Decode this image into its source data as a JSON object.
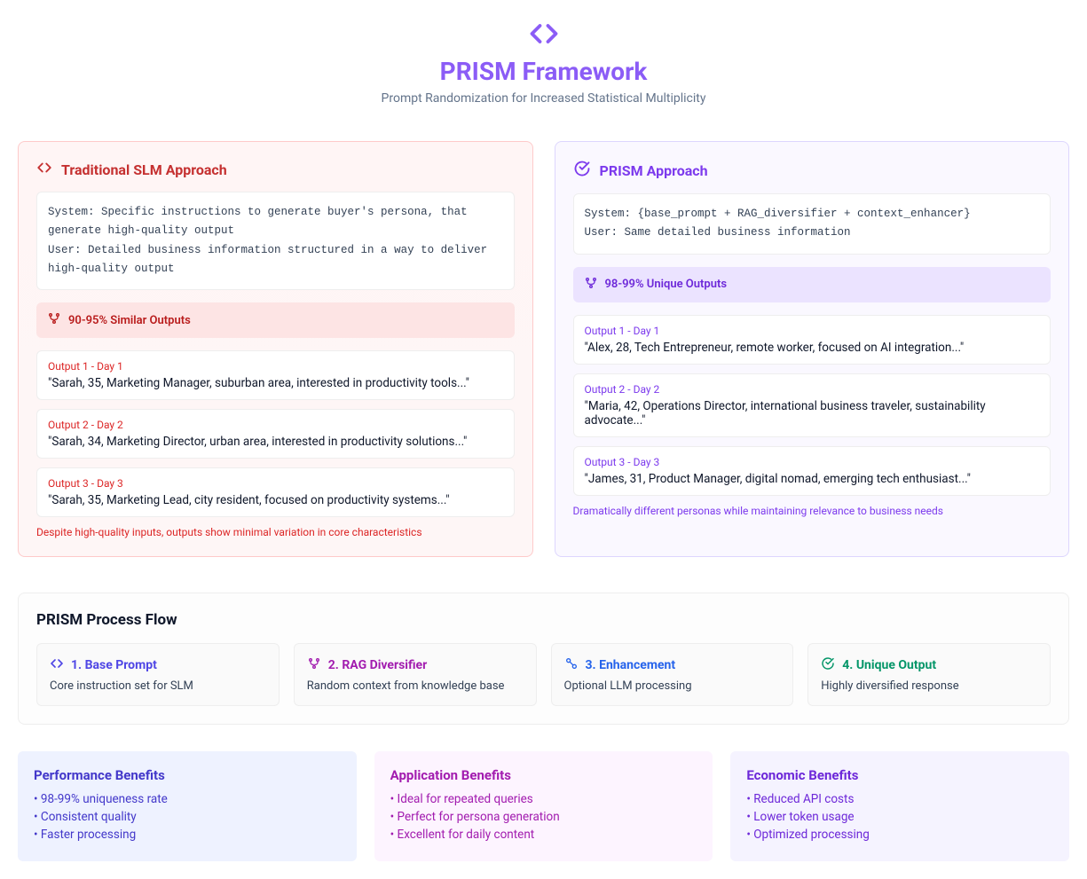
{
  "header": {
    "title": "PRISM Framework",
    "subtitle": "Prompt Randomization for Increased Statistical Multiplicity"
  },
  "traditional": {
    "title": "Traditional SLM Approach",
    "system": "System: Specific instructions to generate buyer's persona, that generate high-quality output",
    "user": "User: Detailed business information structured in a way to deliver high-quality output",
    "similarity": "90-95% Similar Outputs",
    "outputs": [
      {
        "label": "Output 1 - Day 1",
        "text": "\"Sarah, 35, Marketing Manager, suburban area, interested in productivity tools...\""
      },
      {
        "label": "Output 2 - Day 2",
        "text": "\"Sarah, 34, Marketing Director, urban area, interested in productivity solutions...\""
      },
      {
        "label": "Output 3 - Day 3",
        "text": "\"Sarah, 35, Marketing Lead, city resident, focused on productivity systems...\""
      }
    ],
    "note": "Despite high-quality inputs, outputs show minimal variation in core characteristics"
  },
  "prism": {
    "title": "PRISM Approach",
    "system": "System: {base_prompt + RAG_diversifier + context_enhancer}",
    "user": "User: Same detailed business information",
    "similarity": "98-99% Unique Outputs",
    "outputs": [
      {
        "label": "Output 1 - Day 1",
        "text": "\"Alex, 28, Tech Entrepreneur, remote worker, focused on AI integration...\""
      },
      {
        "label": "Output 2 - Day 2",
        "text": "\"Maria, 42, Operations Director, international business traveler, sustainability advocate...\""
      },
      {
        "label": "Output 3 - Day 3",
        "text": "\"James, 31, Product Manager, digital nomad, emerging tech enthusiast...\""
      }
    ],
    "note": "Dramatically different personas while maintaining relevance to business needs"
  },
  "flow": {
    "title": "PRISM Process Flow",
    "steps": [
      {
        "label": "1. Base Prompt",
        "desc": "Core instruction set for SLM"
      },
      {
        "label": "2. RAG Diversifier",
        "desc": "Random context from knowledge base"
      },
      {
        "label": "3. Enhancement",
        "desc": "Optional LLM processing"
      },
      {
        "label": "4. Unique Output",
        "desc": "Highly diversified response"
      }
    ]
  },
  "benefits": [
    {
      "title": "Performance Benefits",
      "items": [
        "• 98-99% uniqueness rate",
        "• Consistent quality",
        "• Faster processing"
      ]
    },
    {
      "title": "Application Benefits",
      "items": [
        "• Ideal for repeated queries",
        "• Perfect for persona generation",
        "• Excellent for daily content"
      ]
    },
    {
      "title": "Economic Benefits",
      "items": [
        "• Reduced API costs",
        "• Lower token usage",
        "• Optimized processing"
      ]
    }
  ]
}
